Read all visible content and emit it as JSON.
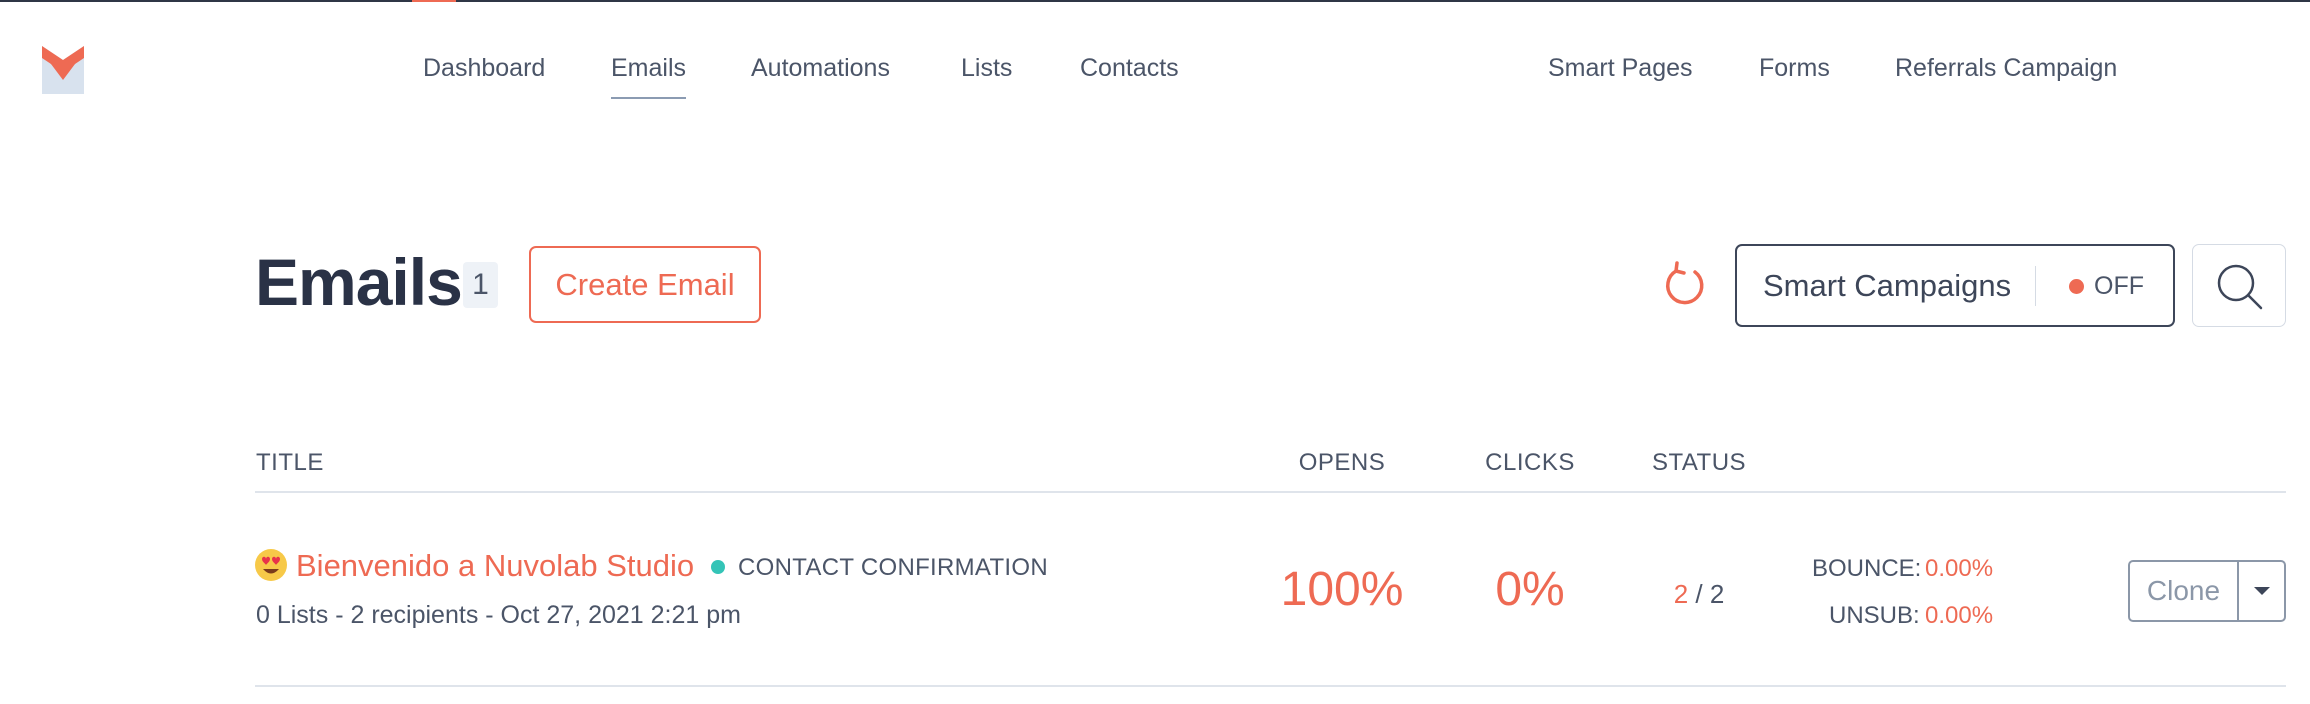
{
  "nav": {
    "left": [
      "Dashboard",
      "Emails",
      "Automations",
      "Lists",
      "Contacts"
    ],
    "right": [
      "Smart Pages",
      "Forms",
      "Referrals Campaign"
    ],
    "active": "Emails"
  },
  "header": {
    "title": "Emails",
    "count": "1",
    "create_label": "Create Email",
    "smart_campaigns_label": "Smart Campaigns",
    "smart_campaigns_state": "OFF"
  },
  "table": {
    "columns": {
      "title": "TITLE",
      "opens": "OPENS",
      "clicks": "CLICKS",
      "status": "STATUS"
    },
    "rows": [
      {
        "emoji": "heart-eyes-emoji",
        "title": "Bienvenido a Nuvolab Studio",
        "type": "CONTACT CONFIRMATION",
        "meta": "0 Lists - 2 recipients - Oct 27, 2021 2:21 pm",
        "opens": "100%",
        "clicks": "0%",
        "status_sent": "2",
        "status_total": "/ 2",
        "bounce_label": "BOUNCE:",
        "bounce_value": "0.00%",
        "unsub_label": "UNSUB:",
        "unsub_value": "0.00%",
        "clone_label": "Clone"
      }
    ]
  },
  "colors": {
    "accent": "#ee6a53",
    "text": "#3d4659",
    "teal_dot": "#34c4b7",
    "border": "#dfe4eb"
  }
}
